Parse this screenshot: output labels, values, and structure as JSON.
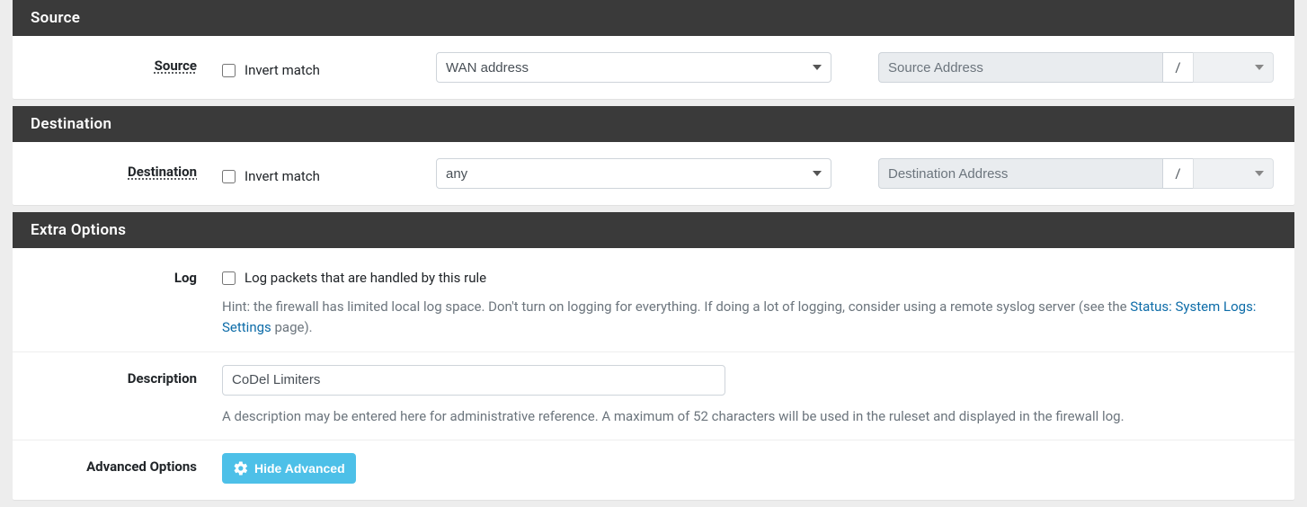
{
  "source": {
    "heading": "Source",
    "label": "Source",
    "invert_label": "Invert match",
    "invert_checked": false,
    "type_selected": "WAN address",
    "address_placeholder": "Source Address",
    "address_value": "",
    "slash": "/",
    "mask_value": ""
  },
  "destination": {
    "heading": "Destination",
    "label": "Destination",
    "invert_label": "Invert match",
    "invert_checked": false,
    "type_selected": "any",
    "address_placeholder": "Destination Address",
    "address_value": "",
    "slash": "/",
    "mask_value": ""
  },
  "extra": {
    "heading": "Extra Options",
    "log": {
      "label": "Log",
      "checkbox_label": "Log packets that are handled by this rule",
      "checked": false,
      "hint_prefix": "Hint: the firewall has limited local log space. Don't turn on logging for everything. If doing a lot of logging, consider using a remote syslog server (see the ",
      "hint_link_text": "Status: System Logs: Settings",
      "hint_suffix": " page)."
    },
    "description": {
      "label": "Description",
      "value": "CoDel Limiters",
      "hint": "A description may be entered here for administrative reference. A maximum of 52 characters will be used in the ruleset and displayed in the firewall log."
    },
    "advanced": {
      "label": "Advanced Options",
      "button_label": "Hide Advanced"
    }
  }
}
